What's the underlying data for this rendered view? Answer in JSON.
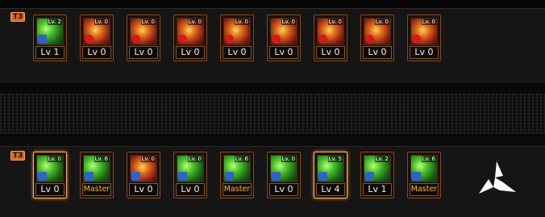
{
  "row1": {
    "tier_label": "T3",
    "skills": [
      {
        "name": "skill-1",
        "icon_level": "Lv. 2",
        "level": "Lv 1",
        "style": "green",
        "badge": "ex"
      },
      {
        "name": "skill-2",
        "icon_level": "Lv. 0",
        "level": "Lv 0",
        "style": "red",
        "badge": "warn"
      },
      {
        "name": "skill-3",
        "icon_level": "Lv. 0",
        "level": "Lv 0",
        "style": "red",
        "badge": "warn"
      },
      {
        "name": "skill-4",
        "icon_level": "Lv. 0",
        "level": "Lv 0",
        "style": "red",
        "badge": "warn"
      },
      {
        "name": "skill-5",
        "icon_level": "Lv. 0",
        "level": "Lv 0",
        "style": "red",
        "badge": "warn"
      },
      {
        "name": "skill-6",
        "icon_level": "Lv. 0",
        "level": "Lv 0",
        "style": "red",
        "badge": "warn"
      },
      {
        "name": "skill-7",
        "icon_level": "Lv. 0",
        "level": "Lv 0",
        "style": "red",
        "badge": "warn"
      },
      {
        "name": "skill-8",
        "icon_level": "Lv. 0",
        "level": "Lv 0",
        "style": "red",
        "badge": "warn"
      },
      {
        "name": "skill-9",
        "icon_level": "Lv. 0",
        "level": "Lv 0",
        "style": "red",
        "badge": "warn"
      }
    ]
  },
  "row2": {
    "tier_label": "T3",
    "skills": [
      {
        "name": "skill-10",
        "icon_level": "Lv. 0",
        "level": "Lv 0",
        "style": "green",
        "badge": "ex",
        "selected": true
      },
      {
        "name": "skill-11",
        "icon_level": "Lv. 6",
        "level": "Master",
        "style": "green",
        "badge": "ex"
      },
      {
        "name": "skill-12",
        "icon_level": "Lv. 0",
        "level": "Lv 0",
        "style": "red",
        "badge": "ex"
      },
      {
        "name": "skill-13",
        "icon_level": "Lv. 0",
        "level": "Lv 0",
        "style": "green",
        "badge": "ex"
      },
      {
        "name": "skill-14",
        "icon_level": "Lv. 6",
        "level": "Master",
        "style": "green",
        "badge": "ex"
      },
      {
        "name": "skill-15",
        "icon_level": "Lv. 0",
        "level": "Lv 0",
        "style": "green",
        "badge": "ex"
      },
      {
        "name": "skill-16",
        "icon_level": "Lv. 5",
        "level": "Lv 4",
        "style": "green",
        "badge": "ex",
        "selected": true
      },
      {
        "name": "skill-17",
        "icon_level": "Lv. 2",
        "level": "Lv 1",
        "style": "green",
        "badge": "ex"
      },
      {
        "name": "skill-18",
        "icon_level": "Lv. 6",
        "level": "Master",
        "style": "green",
        "badge": "ex"
      }
    ]
  },
  "colors": {
    "accent": "#d36a22",
    "master_text": "#ffb82e"
  },
  "icons": {
    "logo": "tri-blade-logo-icon",
    "ex_badge": "ex-badge-icon",
    "warn_badge": "warning-badge-icon"
  }
}
